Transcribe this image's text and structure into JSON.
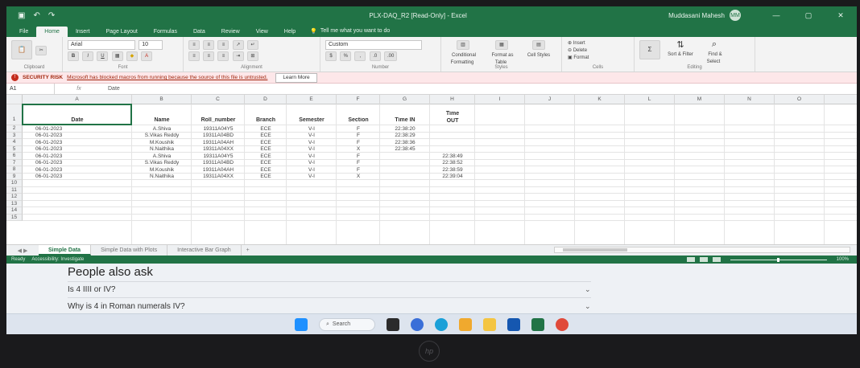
{
  "window": {
    "title": "PLX-DAQ_R2 [Read-Only] - Excel",
    "user": "Muddasani Mahesh",
    "avatar": "MM",
    "quick_access": [
      "save-icon",
      "undo-icon",
      "redo-icon"
    ]
  },
  "ribbon": {
    "tabs": [
      "File",
      "Home",
      "Insert",
      "Page Layout",
      "Formulas",
      "Data",
      "Review",
      "View",
      "Help"
    ],
    "active_tab": "Home",
    "tell_me": "Tell me what you want to do",
    "clipboard": {
      "paste": "Paste",
      "label": "Clipboard"
    },
    "font": {
      "name": "Arial",
      "size": "10",
      "label": "Font"
    },
    "alignment": {
      "label": "Alignment"
    },
    "number": {
      "format": "Custom",
      "label": "Number"
    },
    "styles": {
      "conditional": "Conditional Formatting",
      "format_table": "Format as Table",
      "cell_styles": "Cell Styles",
      "label": "Styles"
    },
    "cells": {
      "insert": "Insert",
      "delete": "Delete",
      "format": "Format",
      "label": "Cells"
    },
    "editing": {
      "sort": "Sort & Filter",
      "find": "Find & Select",
      "label": "Editing"
    }
  },
  "security_bar": {
    "title": "SECURITY RISK",
    "message": "Microsoft has blocked macros from running because the source of this file is untrusted.",
    "button": "Learn More"
  },
  "formula_bar": {
    "name_box": "A1",
    "fx": "fx",
    "value": "Date"
  },
  "grid": {
    "columns": [
      "A",
      "B",
      "C",
      "D",
      "E",
      "F",
      "G",
      "H",
      "I",
      "J",
      "K",
      "L",
      "M",
      "N",
      "O"
    ],
    "rows": [
      "1",
      "2",
      "3",
      "4",
      "5",
      "6",
      "7",
      "8",
      "9",
      "10",
      "11",
      "12",
      "13",
      "14",
      "15"
    ],
    "header": {
      "date": "Date",
      "name": "Name",
      "roll": "Roll_number",
      "branch": "Branch",
      "semester": "Semester",
      "section": "Section",
      "time_in": "Time IN",
      "time_out_1": "Time",
      "time_out_2": "OUT"
    },
    "records": [
      [
        "06-01-2023",
        "A.Shiva",
        "19311A04Y5",
        "ECE",
        "V-I",
        "F",
        "22:38:20",
        ""
      ],
      [
        "06-01-2023",
        "S.Vikas Reddy",
        "19311A04BD",
        "ECE",
        "V-I",
        "F",
        "22:38:29",
        ""
      ],
      [
        "06-01-2023",
        "M.Koushik",
        "19311A04AH",
        "ECE",
        "V-I",
        "F",
        "22:38:36",
        ""
      ],
      [
        "06-01-2023",
        "N.Naithika",
        "19311A04XX",
        "ECE",
        "V-I",
        "X",
        "22:38:45",
        ""
      ],
      [
        "06-01-2023",
        "A.Shiva",
        "19311A04Y5",
        "ECE",
        "V-I",
        "F",
        "",
        "22:38:49"
      ],
      [
        "06-01-2023",
        "S.Vikas Reddy",
        "19311A04BD",
        "ECE",
        "V-I",
        "F",
        "",
        "22:38:52"
      ],
      [
        "06-01-2023",
        "M.Koushik",
        "19311A04AH",
        "ECE",
        "V-I",
        "F",
        "",
        "22:38:59"
      ],
      [
        "06-01-2023",
        "N.Naithika",
        "19311A04XX",
        "ECE",
        "V-I",
        "X",
        "",
        "22:39:04"
      ]
    ]
  },
  "sheet_tabs": {
    "items": [
      "Simple Data",
      "Simple Data with Plots",
      "Interactive Bar Graph"
    ],
    "active": "Simple Data"
  },
  "status_bar": {
    "state": "Ready",
    "accessibility": "Accessibility: Investigate",
    "zoom": "100%"
  },
  "browser": {
    "people_also_ask": "People also ask",
    "questions": [
      "Is 4 IIII or IV?",
      "Why is 4 in Roman numerals IV?"
    ]
  },
  "taskbar": {
    "search": "Search",
    "apps": [
      "start-icon",
      "file-explorer-icon",
      "copilot-icon",
      "edge-icon",
      "photos-icon",
      "folder-icon",
      "outlook-icon",
      "excel-icon",
      "chrome-icon"
    ]
  },
  "colors": {
    "excel_green": "#217346",
    "security_red": "#a1260d"
  }
}
